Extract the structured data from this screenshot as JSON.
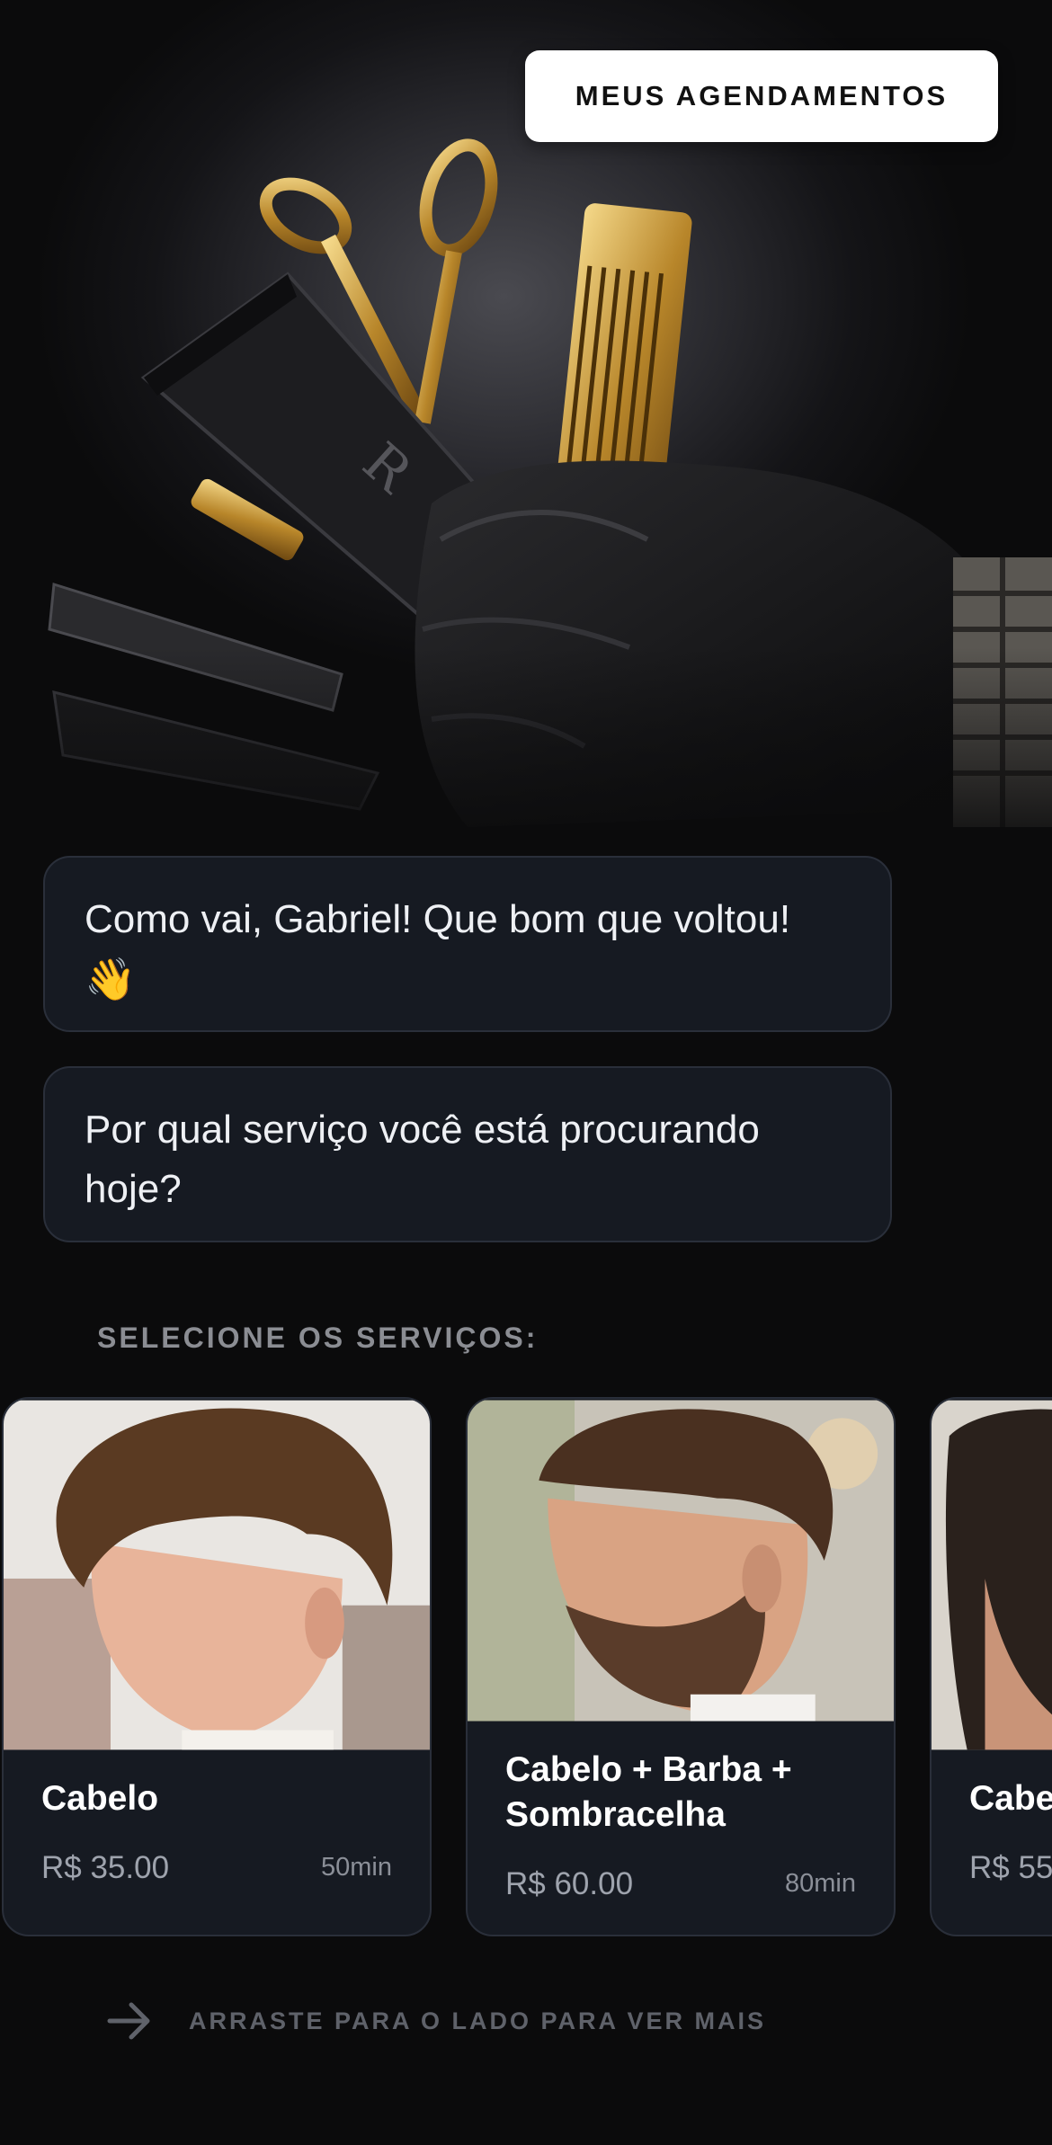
{
  "header": {
    "appointments_button": "MEUS AGENDAMENTOS"
  },
  "chat": {
    "greeting": "Como vai, Gabriel! Que bom que voltou!",
    "greeting_emoji": "👋",
    "question": "Por qual serviço você está procurando hoje?"
  },
  "services": {
    "label": "SELECIONE OS SERVIÇOS:",
    "items": [
      {
        "title": "Cabelo",
        "price": "R$ 35.00",
        "duration": "50min"
      },
      {
        "title": "Cabelo + Barba + Sombracelha",
        "price": "R$ 60.00",
        "duration": "80min"
      },
      {
        "title": "Cabe",
        "price": "R$ 55",
        "duration": ""
      }
    ]
  },
  "hint": {
    "icon": "arrow-right-icon",
    "text": "ARRASTE PARA O LADO PARA VER MAIS"
  }
}
